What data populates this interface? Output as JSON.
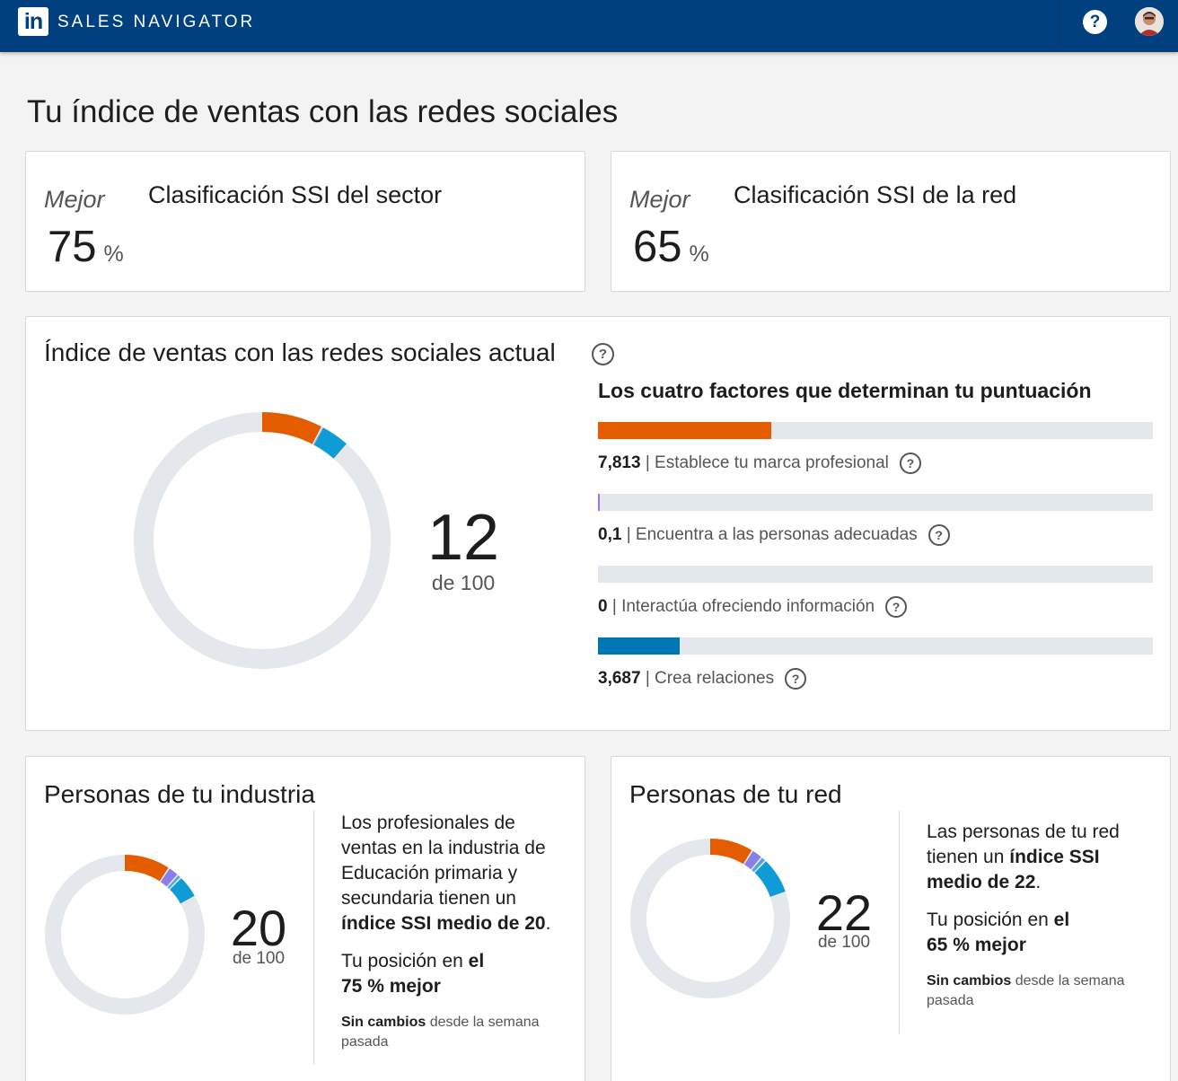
{
  "header": {
    "logo_text": "in",
    "brand": "SALES NAVIGATOR",
    "help_label": "?",
    "colors": {
      "bar": "#00407f"
    }
  },
  "page": {
    "title": "Tu índice de ventas con las redes sociales"
  },
  "rankings": [
    {
      "best_label": "Mejor",
      "title": "Clasificación SSI del sector",
      "value": "75",
      "unit": "%"
    },
    {
      "best_label": "Mejor",
      "title": "Clasificación SSI de la red",
      "value": "65",
      "unit": "%"
    }
  ],
  "ssi": {
    "title": "Índice de ventas con las redes sociales actual",
    "help_icon": "?",
    "score": "12",
    "out_of": "de 100",
    "factors_heading": "Los cuatro factores que determinan tu puntuación",
    "factors": [
      {
        "value": "7,813",
        "separator": "|",
        "label": "Establece tu marca profesional",
        "score": 7.813,
        "max": 25,
        "color": "#e35d00"
      },
      {
        "value": "0,1",
        "separator": "|",
        "label": "Encuentra a las personas adecuadas",
        "score": 0.1,
        "max": 25,
        "color": "#8b7ee8"
      },
      {
        "value": "0",
        "separator": "|",
        "label": "Interactúa ofreciendo información",
        "score": 0,
        "max": 25,
        "color": "#0e9bd6"
      },
      {
        "value": "3,687",
        "separator": "|",
        "label": "Crea relaciones",
        "score": 3.687,
        "max": 25,
        "color": "#0077b5"
      }
    ],
    "donut_segments": [
      {
        "value": 7.813,
        "color": "#e35d00"
      },
      {
        "value": 0.1,
        "color": "#8b7ee8"
      },
      {
        "value": 0,
        "color": "#4aa9d9"
      },
      {
        "value": 3.687,
        "color": "#0e9bd6"
      }
    ]
  },
  "industry": {
    "title": "Personas de tu industria",
    "score": "20",
    "out_of": "de 100",
    "donut_segments": [
      {
        "value": 9.5,
        "color": "#e35d00"
      },
      {
        "value": 2.2,
        "color": "#8b7ee8"
      },
      {
        "value": 0.8,
        "color": "#4aa9d9"
      },
      {
        "value": 4.7,
        "color": "#0e9bd6"
      }
    ],
    "desc_pre": "Los profesionales de ventas en la industria de Educación primaria y secundaria tienen un ",
    "desc_bold": "índice SSI medio de 20",
    "desc_post": ".",
    "pos_pre": "Tu posición en ",
    "pos_bold_1": "el",
    "pos_bold_2": "75 % mejor",
    "note_bold": "Sin cambios",
    "note_rest": " desde la semana pasada"
  },
  "network": {
    "title": "Personas de tu red",
    "score": "22",
    "out_of": "de 100",
    "donut_segments": [
      {
        "value": 9.0,
        "color": "#e35d00"
      },
      {
        "value": 2.3,
        "color": "#8b7ee8"
      },
      {
        "value": 1.0,
        "color": "#4aa9d9"
      },
      {
        "value": 7.5,
        "color": "#0e9bd6"
      }
    ],
    "desc_pre": "Las personas de tu red tienen un ",
    "desc_bold": "índice SSI medio de 22",
    "desc_post": ".",
    "pos_pre": "Tu posición en ",
    "pos_bold_1": "el",
    "pos_bold_2": "65 % mejor",
    "note_bold": "Sin cambios",
    "note_rest": " desde la semana pasada"
  }
}
